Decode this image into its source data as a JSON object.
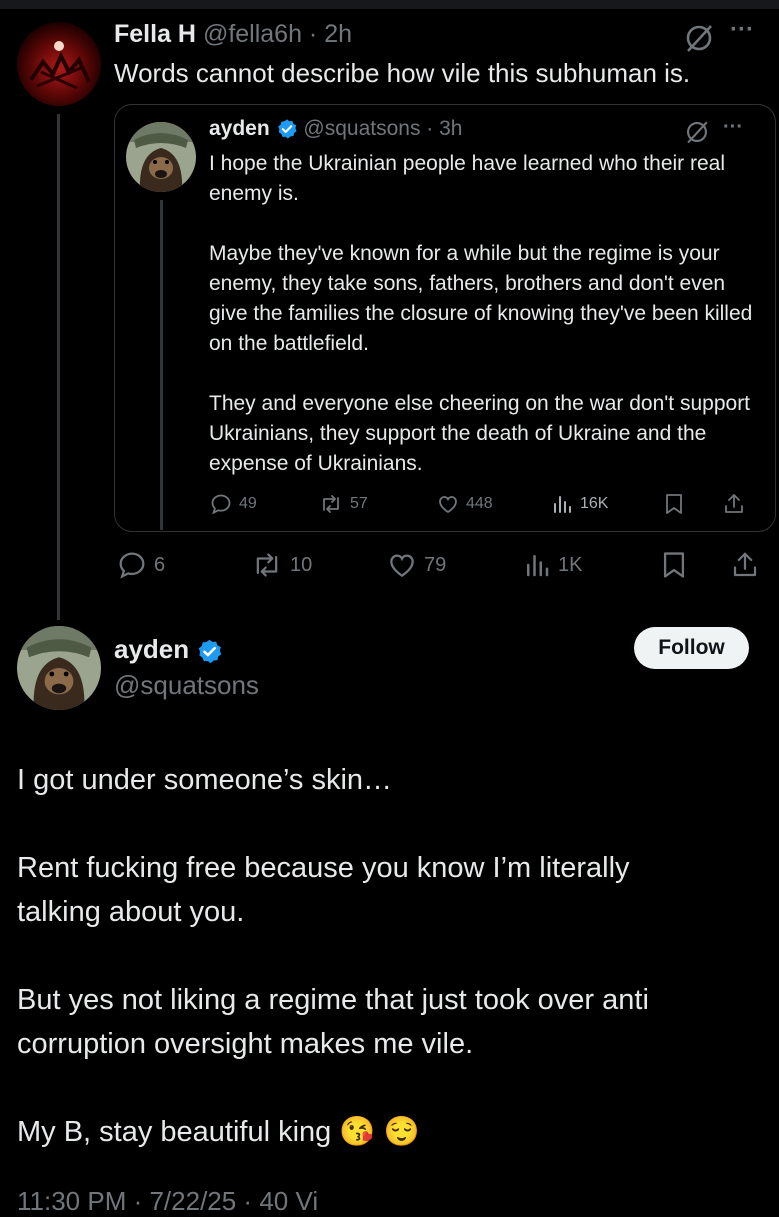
{
  "reply_tweet": {
    "display_name": "Fella H",
    "handle_time": "@fella6h · 2h",
    "text": "Words cannot describe how vile this subhuman is.",
    "more": "···",
    "actions": {
      "replies": "6",
      "reposts": "10",
      "likes": "79",
      "views": "1K"
    }
  },
  "quoted_tweet": {
    "display_name": "ayden",
    "handle_time": "@squatsons · 3h",
    "more": "···",
    "paragraphs": [
      "I hope the Ukrainian people have learned who their real enemy is.",
      "Maybe they've known for a while but the regime is your enemy, they take sons, fathers, brothers and don't even give the families the closure of knowing they've been killed on the battlefield.",
      "They and everyone else cheering on the war don't support Ukrainians, they support the death of Ukraine and the expense of Ukrainians."
    ],
    "actions": {
      "replies": "49",
      "reposts": "57",
      "likes": "448",
      "views": "16K"
    }
  },
  "main_tweet": {
    "display_name": "ayden",
    "handle": "@squatsons",
    "follow_label": "Follow",
    "paragraphs": [
      "I got under someone’s skin…",
      "Rent fucking free because you know I’m literally talking about you.",
      "But yes not liking a regime that just took over anti corruption oversight makes me vile.",
      "My B, stay beautiful king"
    ],
    "emojis": [
      "😘",
      "😌"
    ],
    "footer_partial": "11:30 PM · 7/22/25 · 40 Vi"
  },
  "colors": {
    "background": "#000000",
    "text": "#e7e9ea",
    "muted": "#71767b",
    "verified": "#1d9bf0",
    "border": "#2f3336"
  }
}
